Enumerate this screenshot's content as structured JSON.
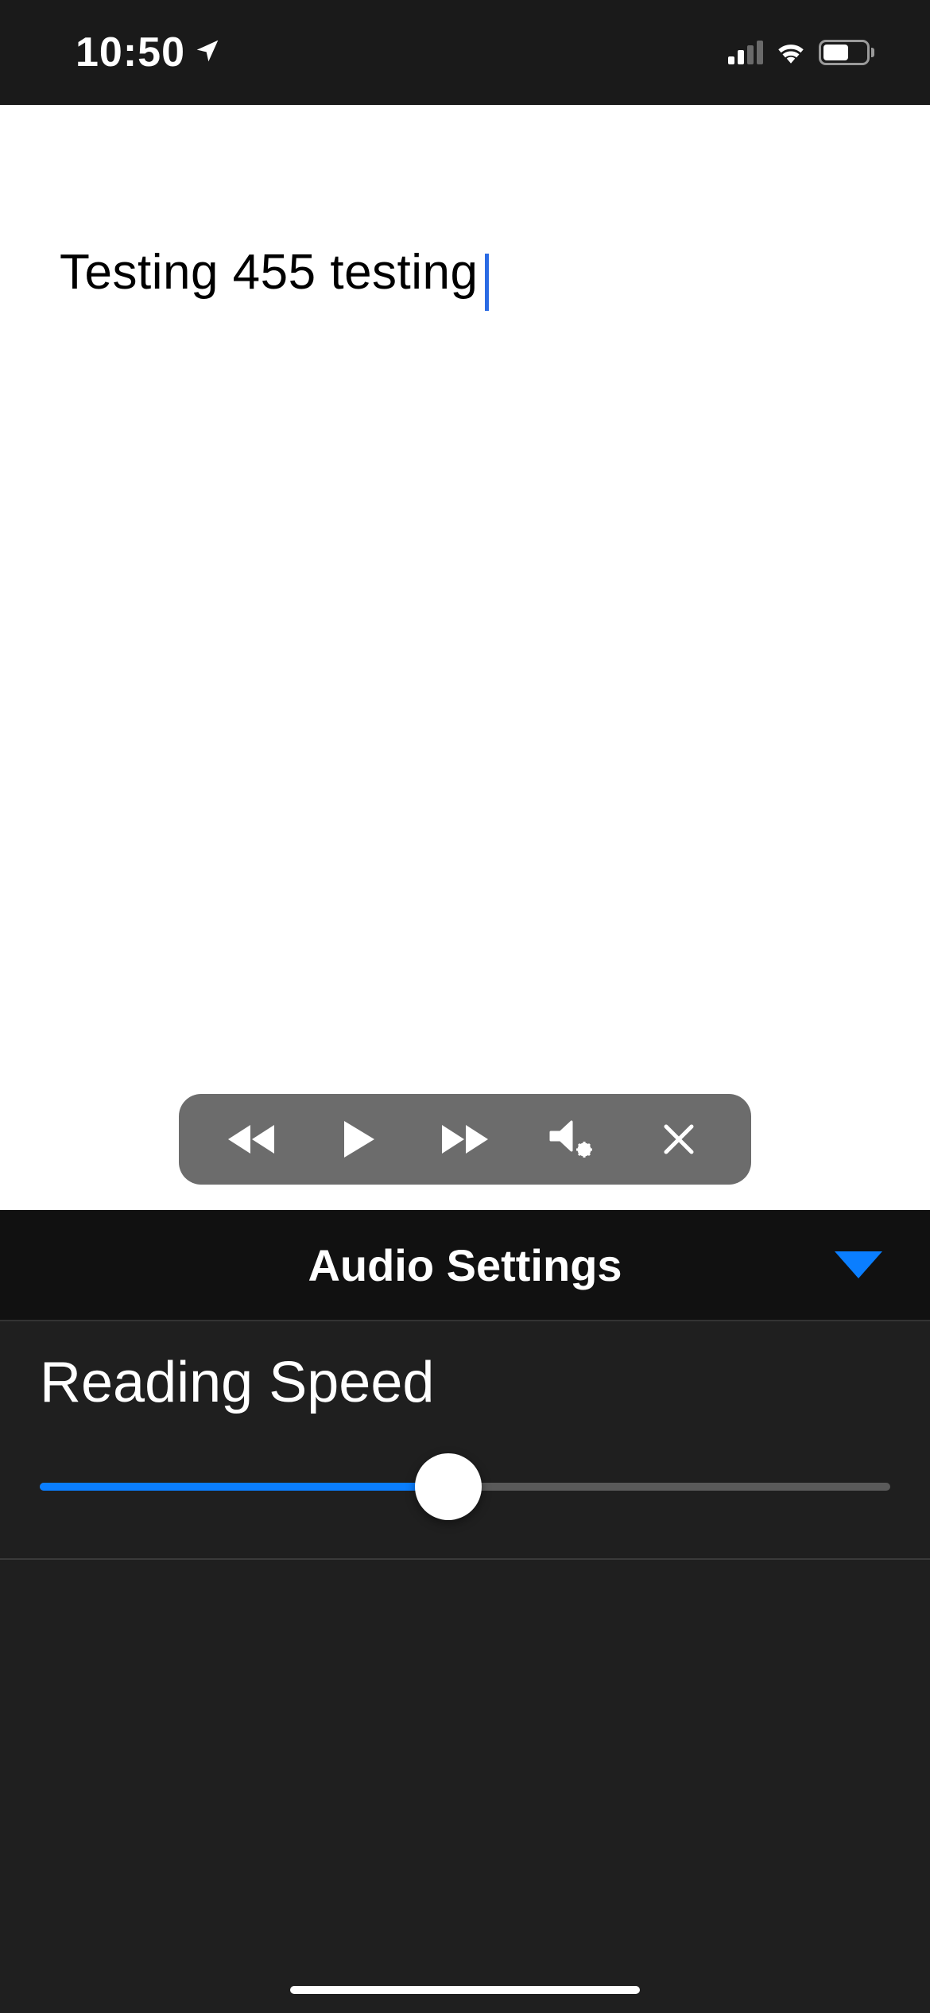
{
  "statusBar": {
    "time": "10:50"
  },
  "content": {
    "text": "Testing 455 testing"
  },
  "audioSettings": {
    "title": "Audio Settings",
    "readingSpeed": {
      "label": "Reading Speed",
      "value": 48
    }
  }
}
